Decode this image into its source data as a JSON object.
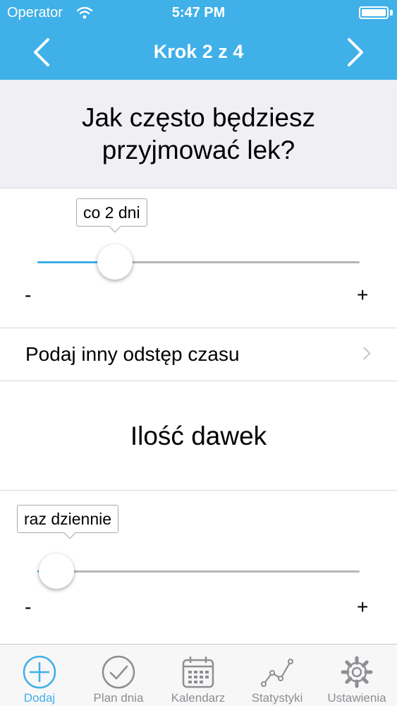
{
  "status_bar": {
    "carrier": "Operator",
    "time": "5:47 PM"
  },
  "nav": {
    "title": "Krok 2 z 4",
    "back_icon": "chevron-left-icon",
    "forward_icon": "chevron-right-icon"
  },
  "question": {
    "text": "Jak często będziesz przyjmować lek?"
  },
  "frequency_slider": {
    "value_label": "co 2 dni",
    "minus": "-",
    "plus": "+",
    "level": 0.24
  },
  "custom_interval": {
    "label": "Podaj inny odstęp czasu"
  },
  "doses_section": {
    "title": "Ilość dawek"
  },
  "doses_slider": {
    "value_label": "raz dziennie",
    "minus": "-",
    "plus": "+",
    "level": 0.06
  },
  "tabbar": {
    "tabs": [
      {
        "label": "Dodaj",
        "icon": "plus-circle-icon",
        "active": true
      },
      {
        "label": "Plan dnia",
        "icon": "checkmark-circle-icon",
        "active": false
      },
      {
        "label": "Kalendarz",
        "icon": "calendar-icon",
        "active": false
      },
      {
        "label": "Statystyki",
        "icon": "line-chart-icon",
        "active": false
      },
      {
        "label": "Ustawienia",
        "icon": "gear-icon",
        "active": false
      }
    ]
  },
  "colors": {
    "accent": "#3fb0e8",
    "inactive": "#8e8e93",
    "header_bg": "#efeff4"
  }
}
